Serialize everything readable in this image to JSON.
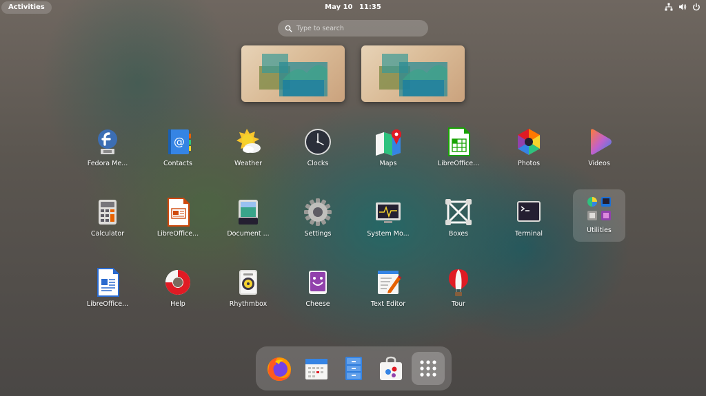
{
  "topbar": {
    "activities_label": "Activities",
    "date": "May 10",
    "time": "11:35"
  },
  "search": {
    "placeholder": "Type to search"
  },
  "apps": [
    {
      "label": "Fedora Me...",
      "icon": "fedora-media-writer-icon"
    },
    {
      "label": "Contacts",
      "icon": "contacts-icon"
    },
    {
      "label": "Weather",
      "icon": "weather-icon"
    },
    {
      "label": "Clocks",
      "icon": "clocks-icon"
    },
    {
      "label": "Maps",
      "icon": "maps-icon"
    },
    {
      "label": "LibreOffice...",
      "icon": "libreoffice-calc-icon"
    },
    {
      "label": "Photos",
      "icon": "photos-icon"
    },
    {
      "label": "Videos",
      "icon": "videos-icon"
    },
    {
      "label": "Calculator",
      "icon": "calculator-icon"
    },
    {
      "label": "LibreOffice...",
      "icon": "libreoffice-impress-icon"
    },
    {
      "label": "Document ...",
      "icon": "document-scanner-icon"
    },
    {
      "label": "Settings",
      "icon": "settings-gear-icon"
    },
    {
      "label": "System Mo...",
      "icon": "system-monitor-icon"
    },
    {
      "label": "Boxes",
      "icon": "boxes-icon"
    },
    {
      "label": "Terminal",
      "icon": "terminal-icon"
    },
    {
      "label": "Utilities",
      "icon": "utilities-folder-icon"
    },
    {
      "label": "LibreOffice...",
      "icon": "libreoffice-writer-icon"
    },
    {
      "label": "Help",
      "icon": "help-lifebuoy-icon"
    },
    {
      "label": "Rhythmbox",
      "icon": "rhythmbox-icon"
    },
    {
      "label": "Cheese",
      "icon": "cheese-icon"
    },
    {
      "label": "Text Editor",
      "icon": "text-editor-icon"
    },
    {
      "label": "Tour",
      "icon": "tour-balloon-icon"
    }
  ],
  "dock": [
    {
      "icon": "firefox-icon"
    },
    {
      "icon": "calendar-icon"
    },
    {
      "icon": "files-icon"
    },
    {
      "icon": "software-icon"
    },
    {
      "icon": "show-apps-grid-icon"
    }
  ],
  "colors": {
    "accent": "#3584e4",
    "panel_overlay": "rgba(255,255,255,0.17)"
  }
}
